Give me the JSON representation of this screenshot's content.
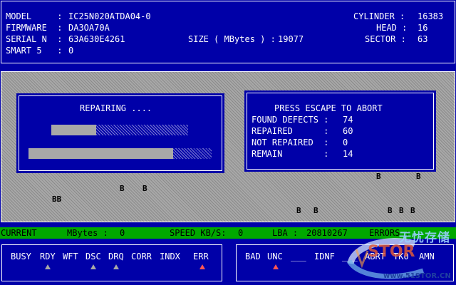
{
  "drive": {
    "model_label": "MODEL     :",
    "model": "IC25N020ATDA04-0",
    "firmware_label": "FIRMWARE  :",
    "firmware": "DA3OA70A",
    "serial_label": "SERIAL N  :",
    "serial": "63A630E4261",
    "smart_label": "SMART 5   :",
    "smart": "0",
    "size_label": "SIZE ( MBytes ) :",
    "size": "19077",
    "cylinder_label": "CYLINDER :",
    "cylinder": "16383",
    "head_label": "HEAD :",
    "head": "16",
    "sector_label": "SECTOR :",
    "sector": "63"
  },
  "repair": {
    "title": "REPAIRING ....",
    "progress_top": 0.33,
    "progress_bottom": 0.79
  },
  "summary": {
    "title": "PRESS ESCAPE TO ABORT",
    "found_label": "FOUND DEFECTS :",
    "found": "74",
    "repaired_label": "REPAIRED      :",
    "repaired": "60",
    "not_repaired_label": "NOT REPAIRED  :",
    "not_repaired": "0",
    "remain_label": "REMAIN        :",
    "remain": "14"
  },
  "bad_blocks": [
    "B",
    "B",
    "BB",
    "B",
    "B",
    "B",
    "B",
    "B",
    "B",
    "B"
  ],
  "status": {
    "current_label": "CURRENT",
    "mbytes_label": "MBytes :",
    "mbytes": "0",
    "speed_label": "SPEED KB/S:",
    "speed": "0",
    "lba_label": "LBA :",
    "lba": "20810267",
    "errors_label": "ERRORS :"
  },
  "status_flags": [
    {
      "label": "BUSY",
      "active": false
    },
    {
      "label": "RDY",
      "active": false
    },
    {
      "label": "WFT",
      "active": false
    },
    {
      "label": "DSC",
      "active": false
    },
    {
      "label": "DRQ",
      "active": false
    },
    {
      "label": "CORR",
      "active": false
    },
    {
      "label": "INDX",
      "active": false
    },
    {
      "label": "ERR",
      "active": true
    }
  ],
  "error_flags": [
    {
      "label": "BAD"
    },
    {
      "label": "UNC"
    },
    {
      "label": "___"
    },
    {
      "label": "IDNF"
    },
    {
      "label": "___"
    },
    {
      "label": "ABRT"
    },
    {
      "label": "TK0"
    },
    {
      "label": "AMN"
    }
  ],
  "watermark": {
    "text_cn": "无忧存储",
    "url": "www.51STOR.CN",
    "logo": "STOR"
  },
  "colors": {
    "bg": "#0000a8",
    "text": "#ffffff",
    "status_bar": "#00a800",
    "gray": "#a8a8a8",
    "active_indicator": "#ff5555"
  }
}
